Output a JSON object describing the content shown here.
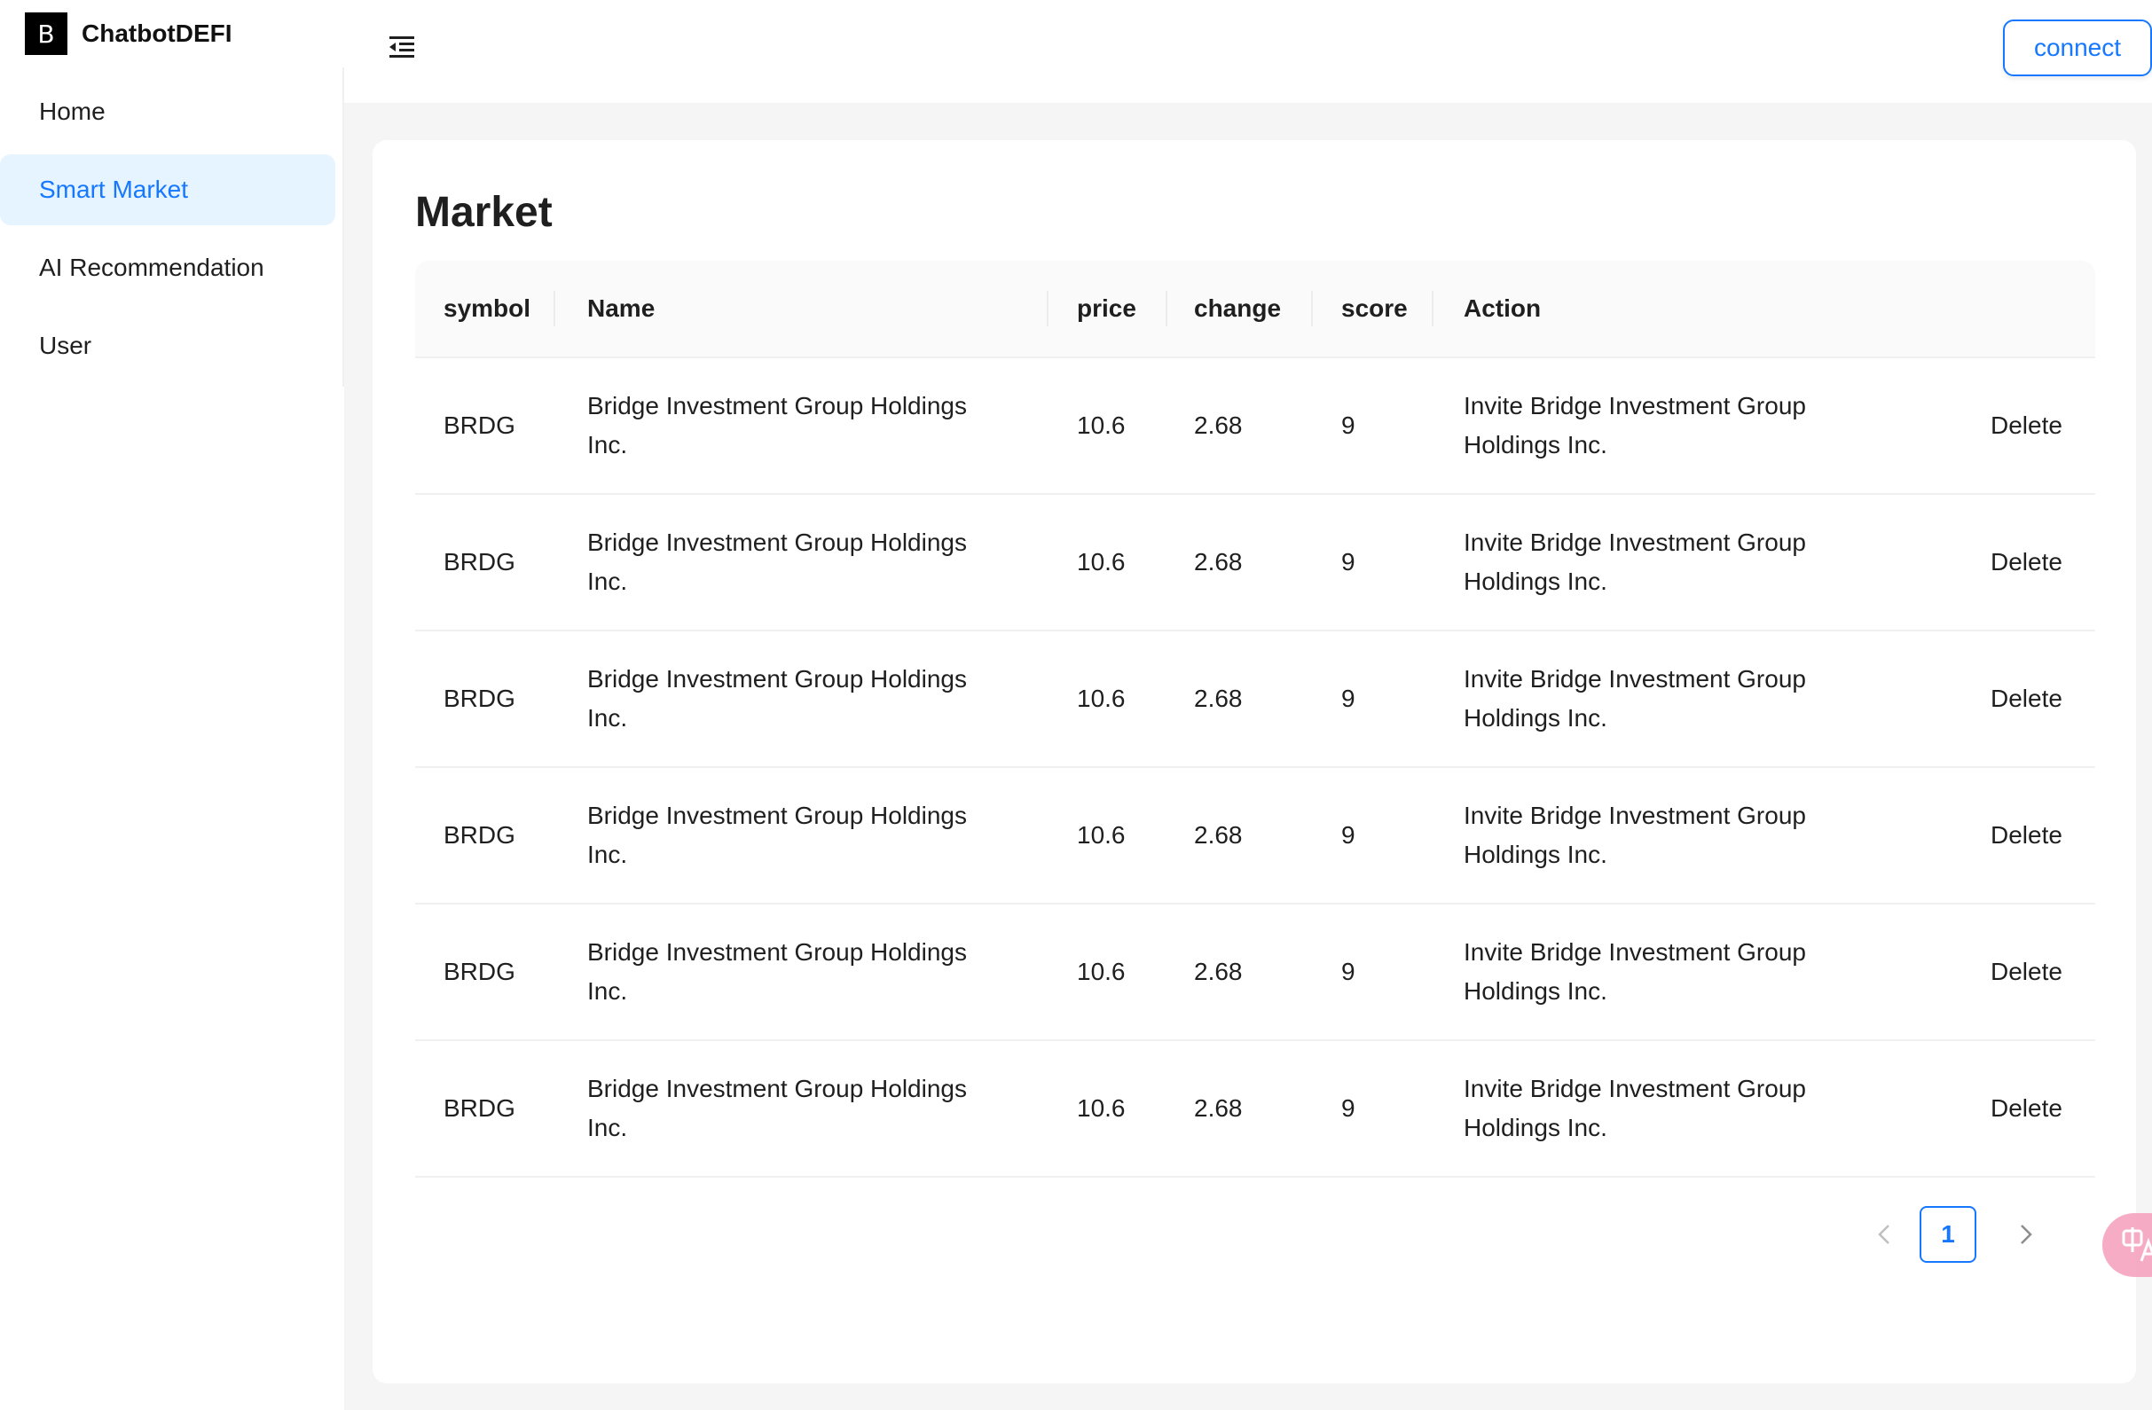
{
  "brand": {
    "logo_letter": "B",
    "name": "ChatbotDEFI"
  },
  "sidebar": {
    "items": [
      {
        "label": "Home"
      },
      {
        "label": "Smart Market"
      },
      {
        "label": "AI Recommendation"
      },
      {
        "label": "User"
      }
    ],
    "active_index": 1
  },
  "header": {
    "collapse_icon": "menu-fold-icon",
    "connect_label": "connect"
  },
  "main": {
    "title": "Market",
    "table": {
      "columns": [
        "symbol",
        "Name",
        "price",
        "change",
        "score",
        "Action"
      ],
      "rows": [
        {
          "symbol": "BRDG",
          "name": "Bridge Investment Group Holdings Inc.",
          "price": "10.6",
          "change": "2.68",
          "score": "9",
          "action": "Invite Bridge Investment Group Holdings Inc.",
          "delete": "Delete"
        },
        {
          "symbol": "BRDG",
          "name": "Bridge Investment Group Holdings Inc.",
          "price": "10.6",
          "change": "2.68",
          "score": "9",
          "action": "Invite Bridge Investment Group Holdings Inc.",
          "delete": "Delete"
        },
        {
          "symbol": "BRDG",
          "name": "Bridge Investment Group Holdings Inc.",
          "price": "10.6",
          "change": "2.68",
          "score": "9",
          "action": "Invite Bridge Investment Group Holdings Inc.",
          "delete": "Delete"
        },
        {
          "symbol": "BRDG",
          "name": "Bridge Investment Group Holdings Inc.",
          "price": "10.6",
          "change": "2.68",
          "score": "9",
          "action": "Invite Bridge Investment Group Holdings Inc.",
          "delete": "Delete"
        },
        {
          "symbol": "BRDG",
          "name": "Bridge Investment Group Holdings Inc.",
          "price": "10.6",
          "change": "2.68",
          "score": "9",
          "action": "Invite Bridge Investment Group Holdings Inc.",
          "delete": "Delete"
        },
        {
          "symbol": "BRDG",
          "name": "Bridge Investment Group Holdings Inc.",
          "price": "10.6",
          "change": "2.68",
          "score": "9",
          "action": "Invite Bridge Investment Group Holdings Inc.",
          "delete": "Delete"
        }
      ]
    },
    "pagination": {
      "current_page": "1",
      "prev_icon": "chevron-left-icon",
      "next_icon": "chevron-right-icon"
    }
  },
  "floating_widget": {
    "icon": "translate-icon"
  },
  "colors": {
    "accent": "#1677ff",
    "active_bg": "#e6f4ff",
    "content_bg": "#f5f5f5",
    "header_row_bg": "#fafafa"
  }
}
